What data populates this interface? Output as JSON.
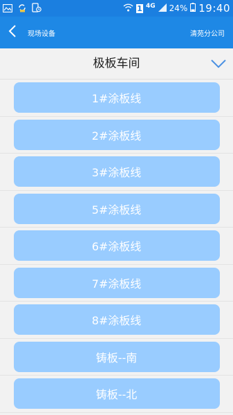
{
  "status_bar": {
    "network": "4G",
    "sim_slot": "1",
    "battery": "24%",
    "time": "19:40"
  },
  "app_bar": {
    "title": "现场设备",
    "company": "清苑分公司"
  },
  "selector": {
    "title": "极板车间"
  },
  "lines": [
    {
      "label": "1#涂板线"
    },
    {
      "label": "2#涂板线"
    },
    {
      "label": "3#涂板线"
    },
    {
      "label": "5#涂板线"
    },
    {
      "label": "6#涂板线"
    },
    {
      "label": "7#涂板线"
    },
    {
      "label": "8#涂板线"
    },
    {
      "label": "铸板--南"
    },
    {
      "label": "铸板--北"
    }
  ],
  "colors": {
    "status_bar": "#1b7fe0",
    "app_bar": "#1e88e5",
    "button": "#99ccff",
    "accent_arrow": "#4a90e2"
  },
  "icons": {
    "back": "back-chevron-icon",
    "dropdown": "chevron-down-icon"
  }
}
